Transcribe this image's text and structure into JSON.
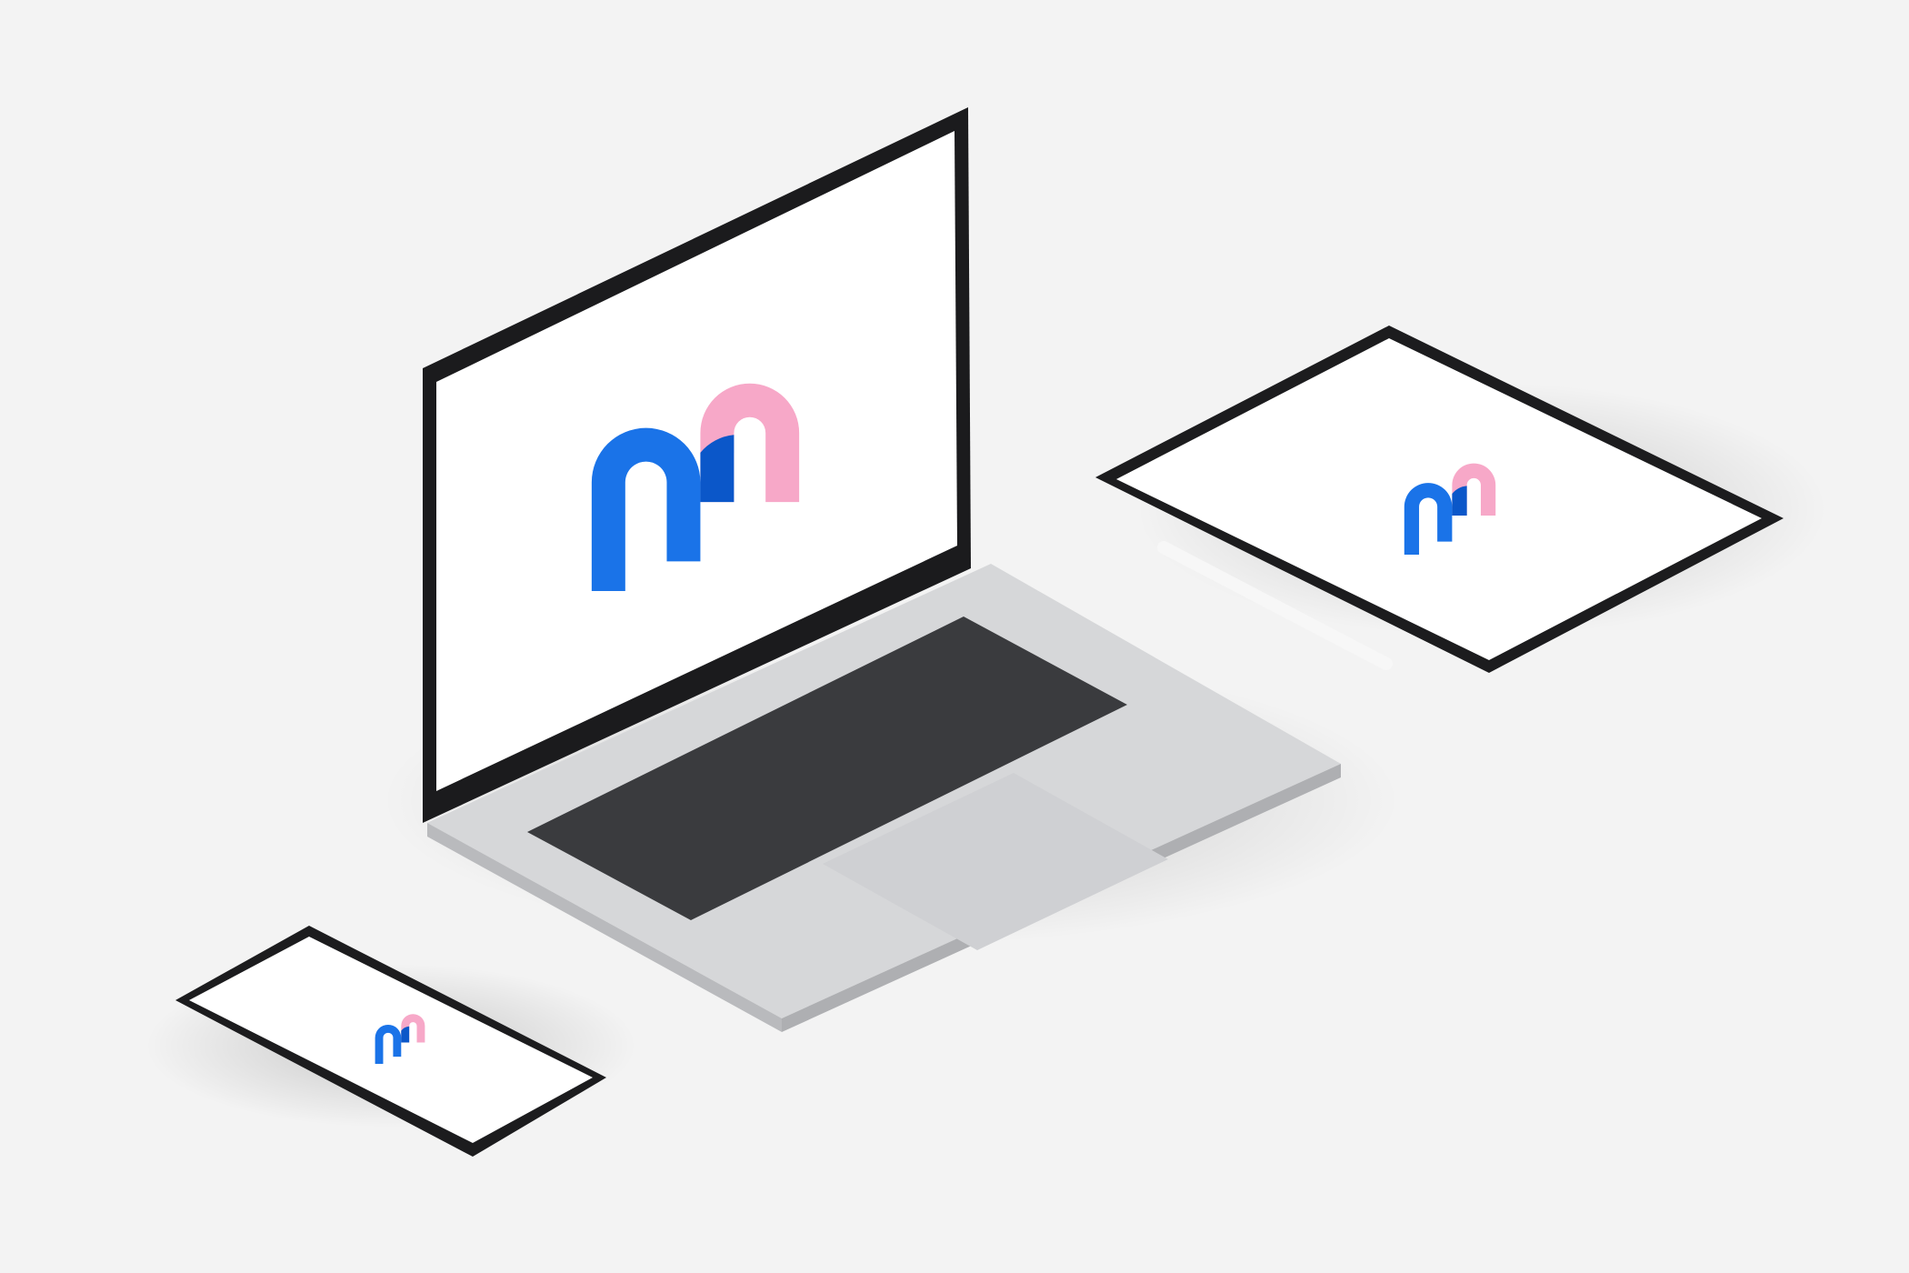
{
  "scene": {
    "background_color": "#f3f3f3"
  },
  "devices": {
    "laptop": {
      "body_color": "#d6d7d9",
      "bezel_color": "#1b1b1d",
      "keyboard_color": "#3a3b3e",
      "screen_color": "#ffffff",
      "screen_icon": "m-logo-icon"
    },
    "tablet": {
      "frame_color": "#1c1c1e",
      "screen_color": "#ffffff",
      "screen_icon": "m-logo-icon"
    },
    "stylus": {
      "color": "#f7f7f7"
    },
    "phone": {
      "frame_color": "#1c1c1e",
      "screen_color": "#ffffff",
      "screen_icon": "m-logo-icon"
    }
  },
  "logo": {
    "left_arch_color": "#1a73e8",
    "right_arch_color": "#f7a8c8",
    "overlap_color": "#0b57c9"
  }
}
